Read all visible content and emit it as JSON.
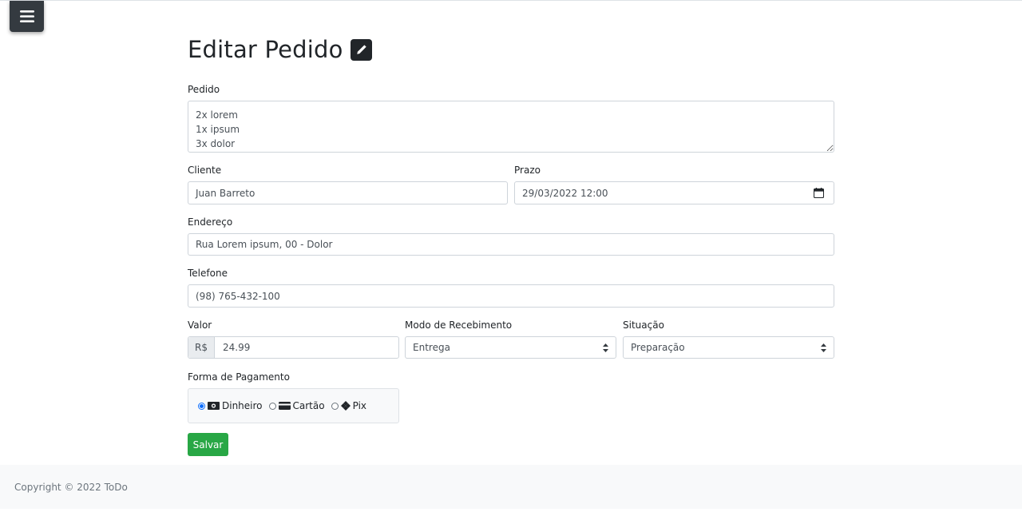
{
  "menu": {
    "icon": "hamburger-icon"
  },
  "page": {
    "title": "Editar Pedido",
    "title_icon": "pencil-square-icon"
  },
  "form": {
    "pedido": {
      "label": "Pedido",
      "value": "2x lorem\n1x ipsum\n3x dolor"
    },
    "cliente": {
      "label": "Cliente",
      "value": "Juan Barreto"
    },
    "prazo": {
      "label": "Prazo",
      "value": "29/03/2022 12:00",
      "icon": "calendar-icon"
    },
    "endereco": {
      "label": "Endereço",
      "value": "Rua Lorem ipsum, 00 - Dolor"
    },
    "telefone": {
      "label": "Telefone",
      "value": "(98) 765-432-100"
    },
    "valor": {
      "label": "Valor",
      "prefix": "R$",
      "value": "24.99"
    },
    "modo": {
      "label": "Modo de Recebimento",
      "selected": "Entrega"
    },
    "situacao": {
      "label": "Situação",
      "selected": "Preparação"
    },
    "pagamento": {
      "label": "Forma de Pagamento",
      "options": [
        {
          "label": "Dinheiro",
          "icon": "cash-icon",
          "checked": true
        },
        {
          "label": "Cartão",
          "icon": "credit-card-icon",
          "checked": false
        },
        {
          "label": "Pix",
          "icon": "pix-icon",
          "checked": false
        }
      ]
    },
    "save_label": "Salvar"
  },
  "footer": {
    "text": "Copyright © 2022 ToDo"
  },
  "colors": {
    "primary": "#0d6efd",
    "success": "#28a745",
    "dark": "#343a40",
    "footer_bg": "#f8f9fa"
  }
}
